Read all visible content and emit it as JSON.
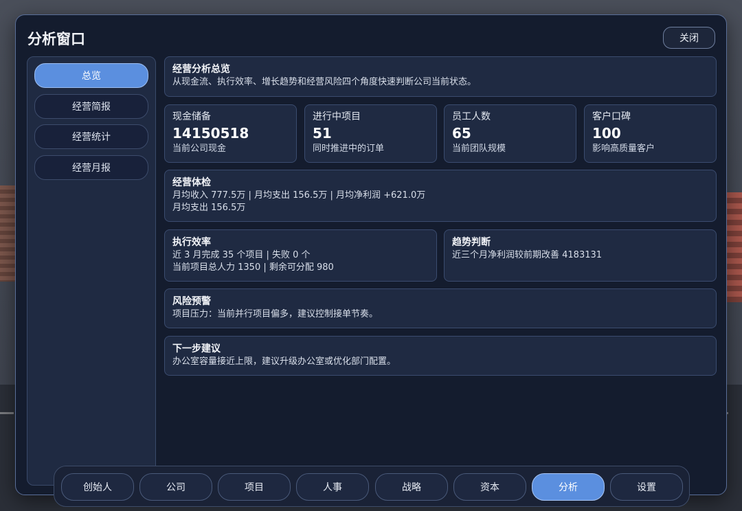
{
  "window": {
    "title": "分析窗口",
    "close_label": "关闭"
  },
  "sidebar": {
    "items": [
      {
        "label": "总览",
        "active": true
      },
      {
        "label": "经营简报",
        "active": false
      },
      {
        "label": "经营统计",
        "active": false
      },
      {
        "label": "经营月报",
        "active": false
      }
    ]
  },
  "overview": {
    "title": "经营分析总览",
    "description": "从现金流、执行效率、增长趋势和经营风险四个角度快速判断公司当前状态。"
  },
  "stats": [
    {
      "label": "现金储备",
      "value": "14150518",
      "sub": "当前公司现金"
    },
    {
      "label": "进行中项目",
      "value": "51",
      "sub": "同时推进中的订单"
    },
    {
      "label": "员工人数",
      "value": "65",
      "sub": "当前团队规模"
    },
    {
      "label": "客户口碑",
      "value": "100",
      "sub": "影响高质量客户"
    }
  ],
  "health": {
    "title": "经营体检",
    "line1": "月均收入 777.5万 | 月均支出 156.5万 | 月均净利润 +621.0万",
    "line2": "月均支出 156.5万"
  },
  "efficiency": {
    "title": "执行效率",
    "line1": "近 3 月完成 35 个项目 | 失败 0 个",
    "line2": "当前项目总人力 1350 | 剩余可分配 980"
  },
  "trend": {
    "title": "趋势判断",
    "line1": "近三个月净利润较前期改善 4183131"
  },
  "risk": {
    "title": "风险预警",
    "line1": "项目压力：当前并行项目偏多，建议控制接单节奏。"
  },
  "next_step": {
    "title": "下一步建议",
    "line1": "办公室容量接近上限，建议升级办公室或优化部门配置。"
  },
  "tabs": [
    {
      "label": "创始人",
      "active": false
    },
    {
      "label": "公司",
      "active": false
    },
    {
      "label": "项目",
      "active": false
    },
    {
      "label": "人事",
      "active": false
    },
    {
      "label": "战略",
      "active": false
    },
    {
      "label": "资本",
      "active": false
    },
    {
      "label": "分析",
      "active": true
    },
    {
      "label": "设置",
      "active": false
    }
  ]
}
